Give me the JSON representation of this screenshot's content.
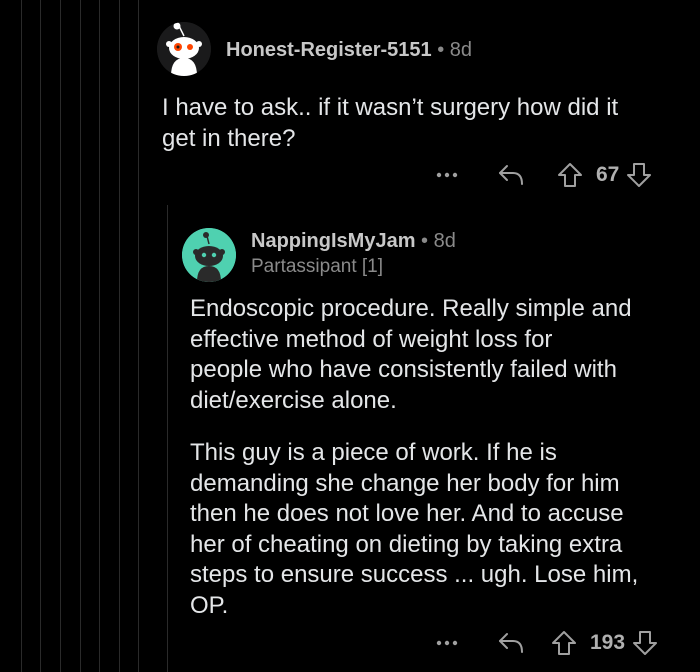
{
  "comments": [
    {
      "username": "Honest-Register-5151",
      "separator": "•",
      "age": "8d",
      "body": "I have to ask.. if it wasn’t surgery how did it\nget in there?",
      "votes": "67",
      "avatar_bg": "#1a1a1b"
    },
    {
      "username": "NappingIsMyJam",
      "separator": "•",
      "age": "8d",
      "flair": "Partassipant [1]",
      "body_p1": "Endoscopic procedure. Really simple and\neffective method of weight loss for\npeople who have consistently failed with\ndiet/exercise alone.",
      "body_p2": "This guy is a piece of work. If he is\ndemanding she change her body for him\nthen he does not love her. And to accuse\nher of cheating on dieting by taking extra\nsteps to ensure success ... ugh. Lose him,\nOP.",
      "votes": "193",
      "avatar_bg": "#4fd1b0"
    }
  ],
  "icons": {
    "more": "more-options-icon",
    "reply": "reply-icon",
    "upvote": "upvote-icon",
    "downvote": "downvote-icon"
  },
  "colors": {
    "background": "#000000",
    "text": "#e4e6e8",
    "muted": "#8a8a8a",
    "avatar_teal": "#4fd1b0"
  }
}
